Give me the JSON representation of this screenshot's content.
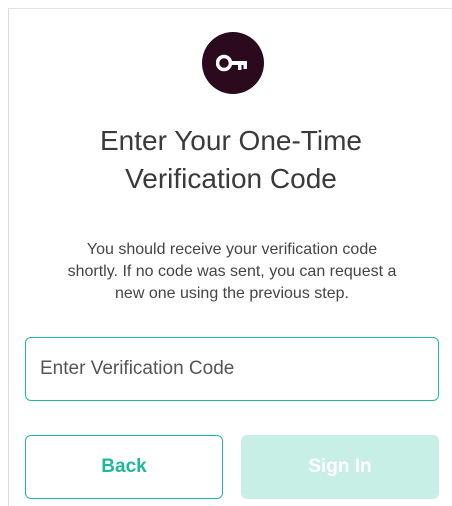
{
  "colors": {
    "brand": "#2a0a1c",
    "accent": "#1fb89a",
    "disabled_bg": "#c8efe5"
  },
  "icon": "key-icon",
  "title": {
    "line1": "Enter Your One-Time",
    "line2": "Verification Code"
  },
  "description": {
    "line1": "You should receive your verification code",
    "line2": "shortly. If no code was sent, you can request a",
    "line3": "new one using the previous step."
  },
  "code_input": {
    "placeholder": "Enter Verification Code",
    "value": ""
  },
  "buttons": {
    "back_label": "Back",
    "signin_label": "Sign In"
  }
}
